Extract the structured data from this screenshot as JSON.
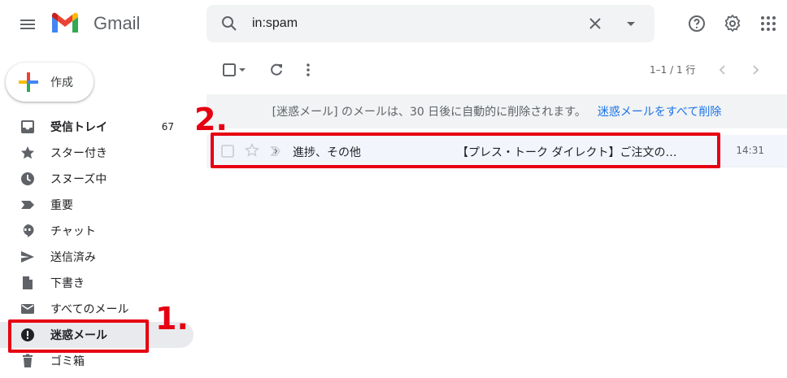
{
  "header": {
    "app_name": "Gmail",
    "search_value": "in:spam",
    "icons": [
      "menu-icon",
      "search-icon",
      "close-icon",
      "dropdown-icon",
      "help-icon",
      "settings-icon",
      "apps-icon"
    ]
  },
  "compose": {
    "label": "作成"
  },
  "sidebar": {
    "items": [
      {
        "label": "受信トレイ",
        "count": "67",
        "icon": "inbox-icon"
      },
      {
        "label": "スター付き",
        "count": "",
        "icon": "star-icon"
      },
      {
        "label": "スヌーズ中",
        "count": "",
        "icon": "clock-icon"
      },
      {
        "label": "重要",
        "count": "",
        "icon": "important-icon"
      },
      {
        "label": "チャット",
        "count": "",
        "icon": "chat-icon"
      },
      {
        "label": "送信済み",
        "count": "",
        "icon": "send-icon"
      },
      {
        "label": "下書き",
        "count": "",
        "icon": "draft-icon"
      },
      {
        "label": "すべてのメール",
        "count": "",
        "icon": "mail-icon"
      },
      {
        "label": "迷惑メール",
        "count": "",
        "icon": "spam-icon"
      },
      {
        "label": "ゴミ箱",
        "count": "",
        "icon": "trash-icon"
      }
    ]
  },
  "toolbar": {
    "pager": "1–1 / 1 行"
  },
  "banner": {
    "message": "[迷惑メール] のメールは、30 日後に自動的に削除されます。",
    "link": "迷惑メールをすべて削除"
  },
  "email": {
    "sender": "進捗、その他",
    "subject": "【プレス・トーク ダイレクト】ご注文の…",
    "time": "14:31"
  },
  "annotations": {
    "step1": "1.",
    "step2": "2.",
    "color": "#e60012"
  }
}
